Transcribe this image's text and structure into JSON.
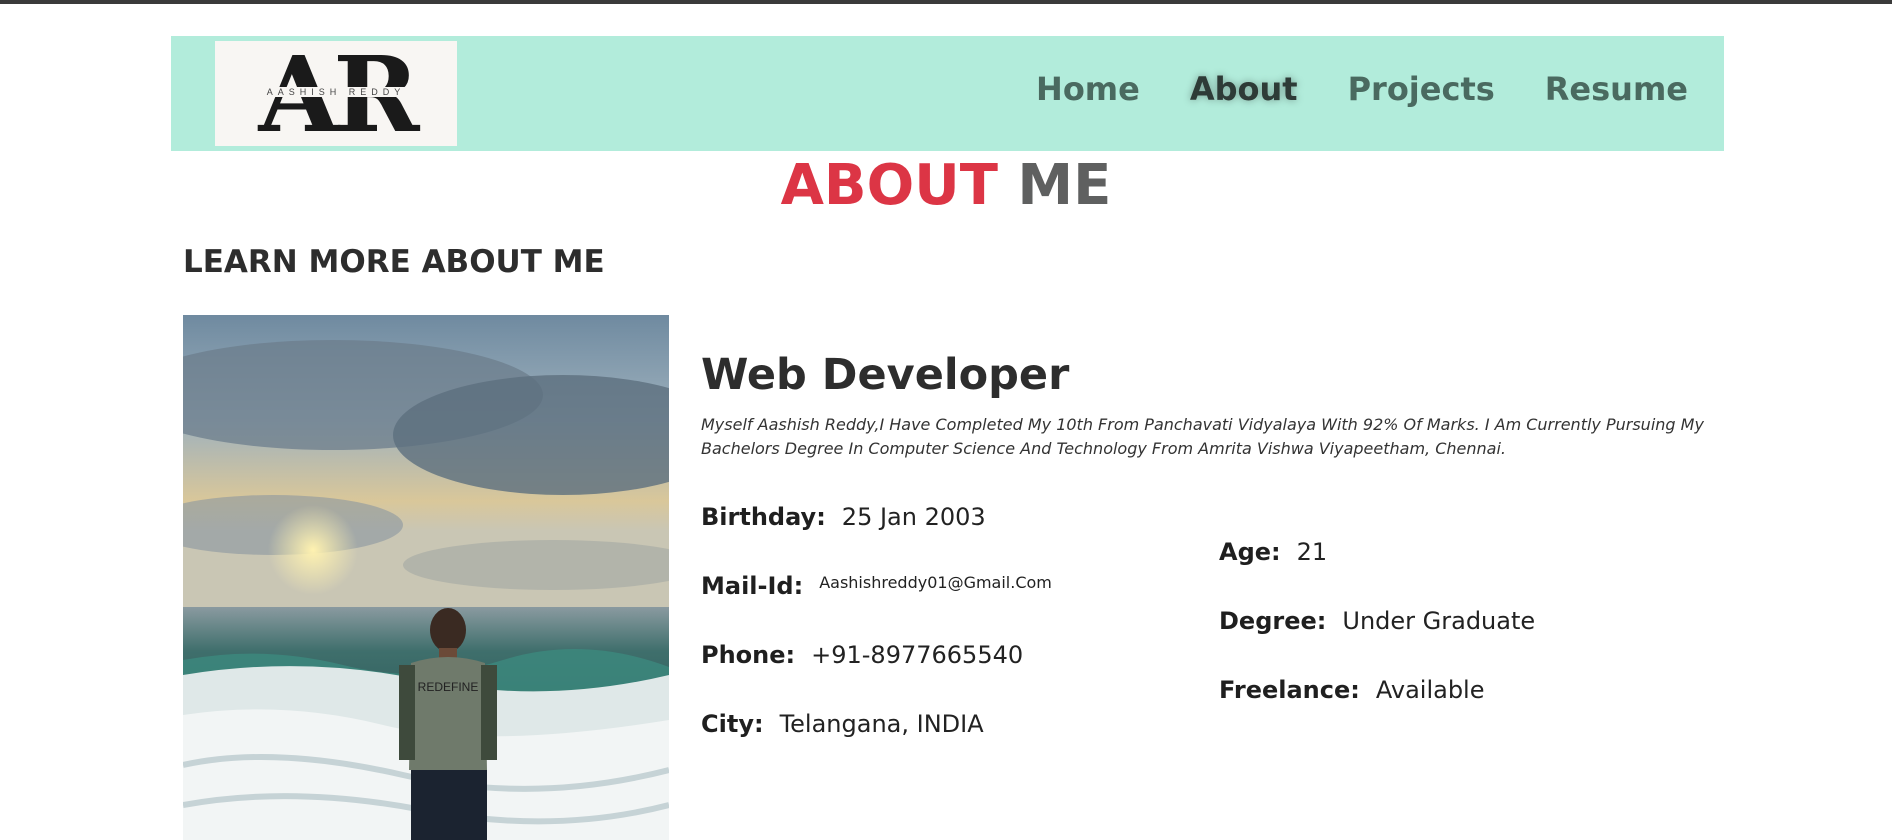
{
  "nav": {
    "logo_text": "AR",
    "logo_subtext": "AASHISH REDDY",
    "items": [
      "Home",
      "About",
      "Projects",
      "Resume"
    ],
    "active": "About",
    "colors": {
      "bar": "#b2ecdb",
      "link": "#4a6a60",
      "active": "#2e3b37"
    }
  },
  "section": {
    "title_accent": "ABOUT",
    "title_rest": "ME",
    "subtitle": "LEARN MORE ABOUT ME",
    "accent_color": "#dc3545"
  },
  "profile": {
    "role": "Web Developer",
    "bio": "Myself Aashish Reddy,I Have Completed My 10th From Panchavati Vidyalaya With 92% Of Marks. I Am Currently Pursuing My Bachelors Degree In Computer Science And Technology From Amrita Vishwa Viyapeetham, Chennai.",
    "photo_shirt_text": "REDEFINE",
    "fields_left": [
      {
        "label": "Birthday:",
        "value": "25 Jan 2003"
      },
      {
        "label": "Mail-Id:",
        "value": "Aashishreddy01@Gmail.Com"
      },
      {
        "label": "Phone:",
        "value": "+91-8977665540"
      },
      {
        "label": "City:",
        "value": "Telangana, INDIA"
      }
    ],
    "fields_right": [
      {
        "label": "Age:",
        "value": "21"
      },
      {
        "label": "Degree:",
        "value": "Under Graduate"
      },
      {
        "label": "Freelance:",
        "value": "Available"
      }
    ]
  }
}
